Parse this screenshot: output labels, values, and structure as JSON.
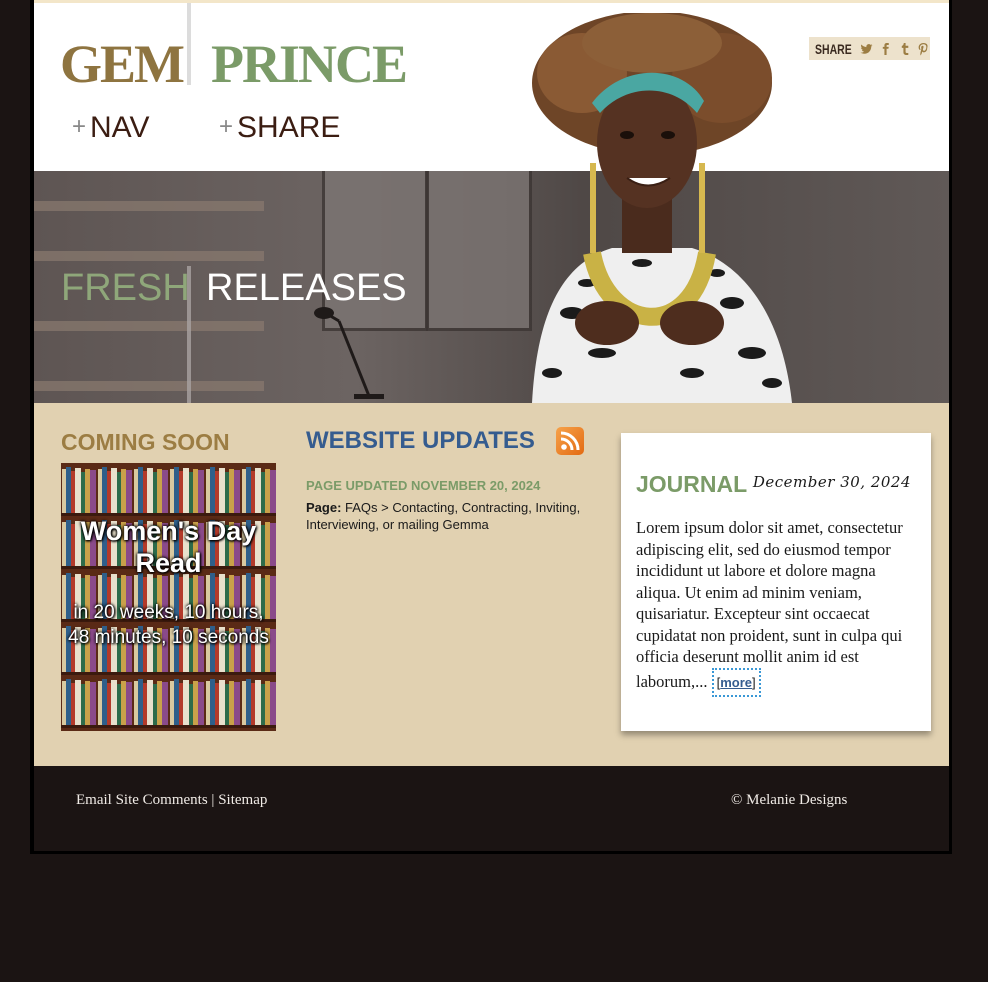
{
  "brand": {
    "first": "GEM",
    "second": "PRINCE",
    "first_color": "#8e7440",
    "second_color": "#7b9b68"
  },
  "header_nav": {
    "nav_label": "NAV",
    "share_label": "SHARE"
  },
  "share_box": {
    "label": "SHARE",
    "icons": [
      "twitter-icon",
      "facebook-icon",
      "tumblr-icon",
      "pinterest-icon"
    ]
  },
  "hero": {
    "word1": "FRESH",
    "word2": "RELEASES"
  },
  "coming_soon": {
    "title": "COMING SOON",
    "book_title": "Women's Day Read",
    "book_detail": "in 20 weeks, 10 hours, 48 minutes, 10 seconds"
  },
  "website_updates": {
    "title": "WEBSITE UPDATES",
    "subtitle": "PAGE UPDATED NOVEMBER 20, 2024",
    "page_label": "Page:",
    "page_text": "FAQs > Contacting, Contracting, Inviting, Interviewing, or mailing Gemma"
  },
  "journal": {
    "title": "JOURNAL",
    "date": "December 30, 2024",
    "body": "Lorem ipsum dolor sit amet, consectetur adipiscing elit, sed do eiusmod tempor incididunt ut labore et dolore magna aliqua. Ut enim ad minim veniam, quisariatur. Excepteur sint occaecat cupidatat non proident, sunt in culpa qui officia deserunt mollit anim id est laborum,...",
    "more_label": "more"
  },
  "footer": {
    "email_link": "Email Site Comments",
    "separator": "|",
    "sitemap_link": "Sitemap",
    "copyright": "© Melanie Designs"
  }
}
